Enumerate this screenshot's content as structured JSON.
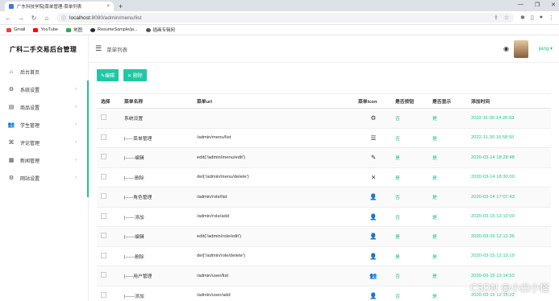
{
  "browser": {
    "tab_title": "广东科技学院|菜单管理-菜单列表",
    "tab_close": "×",
    "new_tab": "+",
    "url_host": "localhost",
    "url_path": ":8080/admin/menu/list",
    "bookmarks": [
      {
        "label": "Gmail",
        "color": "#ea4335"
      },
      {
        "label": "YouTube",
        "color": "#ff0000"
      },
      {
        "label": "地图",
        "color": "#34a853"
      },
      {
        "label": "ResumeSample/ja...",
        "color": "#24292e"
      },
      {
        "label": "插画专辑网",
        "color": "#555555"
      }
    ]
  },
  "sidebar": {
    "brand": "广科二手交易后台管理",
    "items": [
      {
        "label": "后台首页",
        "icon": "home-icon",
        "arrow": ""
      },
      {
        "label": "系统设置",
        "icon": "gear-icon",
        "arrow": "›"
      },
      {
        "label": "商品设置",
        "icon": "shop-icon",
        "arrow": "›"
      },
      {
        "label": "学生管理",
        "icon": "users-icon",
        "arrow": "›"
      },
      {
        "label": "评论管理",
        "icon": "command-icon",
        "arrow": "›"
      },
      {
        "label": "新闻管理",
        "icon": "news-icon",
        "arrow": "›"
      },
      {
        "label": "网站设置",
        "icon": "gear-icon",
        "arrow": "›"
      }
    ]
  },
  "topbar": {
    "crumb": "菜单列表",
    "user": "jiang ▾"
  },
  "toolbar": {
    "edit_label": "✎编辑",
    "delete_label": "✕ 删除"
  },
  "table": {
    "headers": [
      "选择",
      "菜单名称",
      "菜单url",
      "菜单icon",
      "是否按钮",
      "是否显示",
      "添加时间"
    ],
    "rows": [
      {
        "name": "系统设置",
        "url": "",
        "icon": "gear",
        "btn": "否",
        "show": "是",
        "time": "2022-11-30 14:26:03"
      },
      {
        "name": "|-----菜单管理",
        "url": "/admin/menu/list",
        "icon": "list",
        "btn": "否",
        "show": "是",
        "time": "2022-11-30 16:58:55"
      },
      {
        "name": "|------编辑",
        "url": "edit('/admin/menu/edit')",
        "icon": "pencil",
        "btn": "是",
        "show": "是",
        "time": "2020-03-14 18:28:48"
      },
      {
        "name": "|------删除",
        "url": "del('/admin/menu/delete')",
        "icon": "close",
        "btn": "是",
        "show": "是",
        "time": "2020-03-14 18:30:00"
      },
      {
        "name": "|-----角色管理",
        "url": "/admin/role/list",
        "icon": "user-gear",
        "btn": "否",
        "show": "是",
        "time": "2020-03-14 17:07:43"
      },
      {
        "name": "|------添加",
        "url": "/admin/role/add",
        "icon": "user-plus",
        "btn": "否",
        "show": "是",
        "time": "2020-03-15 12:12:00"
      },
      {
        "name": "|------编辑",
        "url": "edit('/admin/role/edit')",
        "icon": "user-edit",
        "btn": "是",
        "show": "是",
        "time": "2020-03-15 12:12:36"
      },
      {
        "name": "|------删除",
        "url": "del('/admin/role/delete')",
        "icon": "user-minus",
        "btn": "是",
        "show": "是",
        "time": "2020-03-15 12:13:19"
      },
      {
        "name": "|-----用户管理",
        "url": "/admin/user/list",
        "icon": "users",
        "btn": "否",
        "show": "是",
        "time": "2020-03-15 12:14:52"
      },
      {
        "name": "|------添加",
        "url": "/admin/user/add",
        "icon": "user-plus",
        "btn": "否",
        "show": "是",
        "time": "2020-03-15 12:15:22"
      }
    ]
  },
  "watermark": "CSDN @小白小怪"
}
